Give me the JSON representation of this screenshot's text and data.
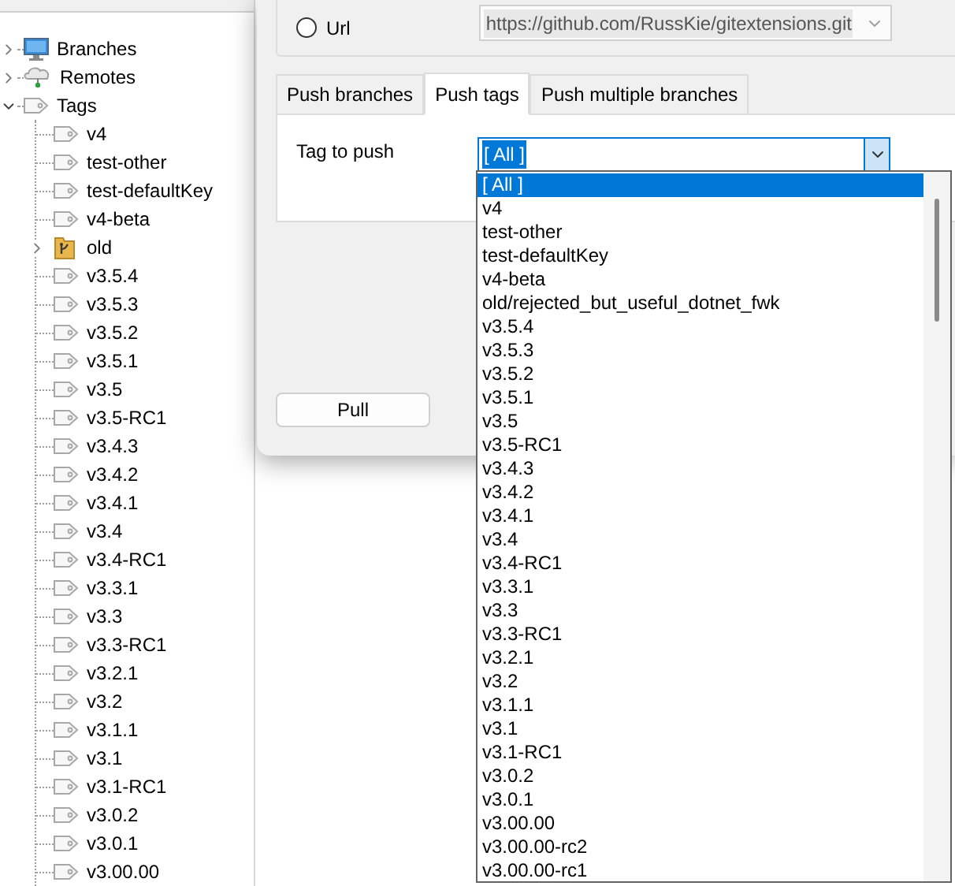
{
  "tree": {
    "items": [
      {
        "label": "Branches",
        "kind": "branches",
        "expanded": false
      },
      {
        "label": "Remotes",
        "kind": "remotes",
        "expanded": false
      },
      {
        "label": "Tags",
        "kind": "tags",
        "expanded": true,
        "children": [
          {
            "label": "v4",
            "kind": "tag"
          },
          {
            "label": "test-other",
            "kind": "tag"
          },
          {
            "label": "test-defaultKey",
            "kind": "tag"
          },
          {
            "label": "v4-beta",
            "kind": "tag"
          },
          {
            "label": "old",
            "kind": "folder",
            "expanded": false
          },
          {
            "label": "v3.5.4",
            "kind": "tag"
          },
          {
            "label": "v3.5.3",
            "kind": "tag"
          },
          {
            "label": "v3.5.2",
            "kind": "tag"
          },
          {
            "label": "v3.5.1",
            "kind": "tag"
          },
          {
            "label": "v3.5",
            "kind": "tag"
          },
          {
            "label": "v3.5-RC1",
            "kind": "tag"
          },
          {
            "label": "v3.4.3",
            "kind": "tag"
          },
          {
            "label": "v3.4.2",
            "kind": "tag"
          },
          {
            "label": "v3.4.1",
            "kind": "tag"
          },
          {
            "label": "v3.4",
            "kind": "tag"
          },
          {
            "label": "v3.4-RC1",
            "kind": "tag"
          },
          {
            "label": "v3.3.1",
            "kind": "tag"
          },
          {
            "label": "v3.3",
            "kind": "tag"
          },
          {
            "label": "v3.3-RC1",
            "kind": "tag"
          },
          {
            "label": "v3.2.1",
            "kind": "tag"
          },
          {
            "label": "v3.2",
            "kind": "tag"
          },
          {
            "label": "v3.1.1",
            "kind": "tag"
          },
          {
            "label": "v3.1",
            "kind": "tag"
          },
          {
            "label": "v3.1-RC1",
            "kind": "tag"
          },
          {
            "label": "v3.0.2",
            "kind": "tag"
          },
          {
            "label": "v3.0.1",
            "kind": "tag"
          },
          {
            "label": "v3.00.00",
            "kind": "tag"
          }
        ]
      }
    ]
  },
  "dialog": {
    "url_option": {
      "label": "Url",
      "selected": false
    },
    "url_field": {
      "value": "https://github.com/RussKie/gitextensions.git",
      "disabled": true
    },
    "tabs": [
      {
        "label": "Push branches",
        "selected": false
      },
      {
        "label": "Push tags",
        "selected": true
      },
      {
        "label": "Push multiple branches",
        "selected": false
      }
    ],
    "tag_label": "Tag to push",
    "tag_combo": {
      "value": "[ All ]"
    },
    "dropdown": {
      "items": [
        {
          "label": "[ All ]",
          "selected": true
        },
        {
          "label": "v4",
          "selected": false
        },
        {
          "label": "test-other",
          "selected": false
        },
        {
          "label": "test-defaultKey",
          "selected": false
        },
        {
          "label": "v4-beta",
          "selected": false
        },
        {
          "label": "old/rejected_but_useful_dotnet_fwk",
          "selected": false
        },
        {
          "label": "v3.5.4",
          "selected": false
        },
        {
          "label": "v3.5.3",
          "selected": false
        },
        {
          "label": "v3.5.2",
          "selected": false
        },
        {
          "label": "v3.5.1",
          "selected": false
        },
        {
          "label": "v3.5",
          "selected": false
        },
        {
          "label": "v3.5-RC1",
          "selected": false
        },
        {
          "label": "v3.4.3",
          "selected": false
        },
        {
          "label": "v3.4.2",
          "selected": false
        },
        {
          "label": "v3.4.1",
          "selected": false
        },
        {
          "label": "v3.4",
          "selected": false
        },
        {
          "label": "v3.4-RC1",
          "selected": false
        },
        {
          "label": "v3.3.1",
          "selected": false
        },
        {
          "label": "v3.3",
          "selected": false
        },
        {
          "label": "v3.3-RC1",
          "selected": false
        },
        {
          "label": "v3.2.1",
          "selected": false
        },
        {
          "label": "v3.2",
          "selected": false
        },
        {
          "label": "v3.1.1",
          "selected": false
        },
        {
          "label": "v3.1",
          "selected": false
        },
        {
          "label": "v3.1-RC1",
          "selected": false
        },
        {
          "label": "v3.0.2",
          "selected": false
        },
        {
          "label": "v3.0.1",
          "selected": false
        },
        {
          "label": "v3.00.00",
          "selected": false
        },
        {
          "label": "v3.00.00-rc2",
          "selected": false
        },
        {
          "label": "v3.00.00-rc1",
          "selected": false
        }
      ]
    },
    "buttons": [
      "Pull"
    ]
  }
}
